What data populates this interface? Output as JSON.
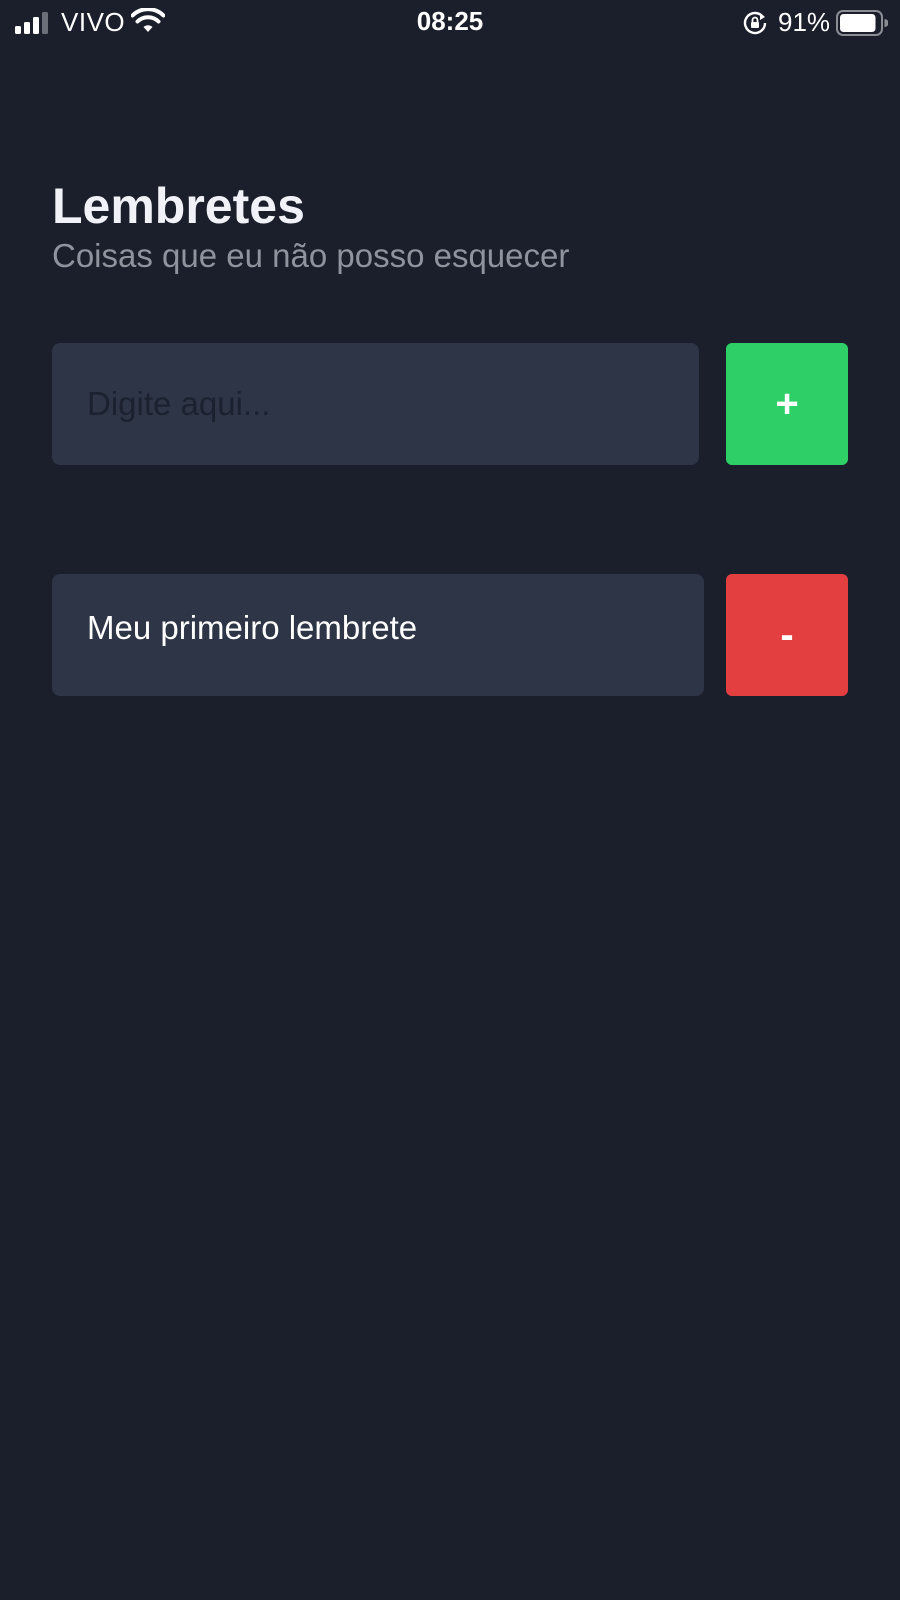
{
  "status_bar": {
    "carrier": "VIVO",
    "time": "08:25",
    "battery_percent": "91%",
    "battery_level": 0.91,
    "signal_bars": 3,
    "icons": [
      "signal-icon",
      "wifi-icon",
      "rotation-lock-icon",
      "battery-icon"
    ]
  },
  "header": {
    "title": "Lembretes",
    "subtitle": "Coisas que eu não posso esquecer"
  },
  "new_reminder": {
    "value": "",
    "placeholder": "Digite aqui...",
    "add_label": "+"
  },
  "reminders": [
    {
      "text": "Meu primeiro lembrete",
      "remove_label": "-"
    }
  ],
  "colors": {
    "background": "#1b1f2b",
    "card": "#2d3547",
    "add_button": "#2fcf68",
    "remove_button": "#e33e40",
    "subtitle": "#8e939d"
  }
}
